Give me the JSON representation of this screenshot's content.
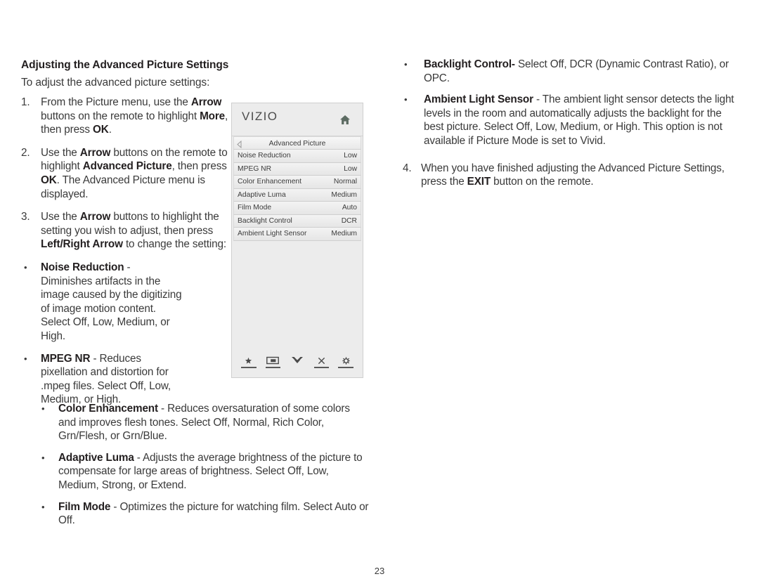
{
  "document": {
    "section_title": "Adjusting the Advanced Picture Settings",
    "intro": "To adjust the advanced picture settings:",
    "page_number": "23"
  },
  "steps_left": [
    {
      "num": "1.",
      "html": "From the Picture menu, use the <b>Arrow</b> buttons on the remote to highlight <b>More</b>, then press <b>OK</b>."
    },
    {
      "num": "2.",
      "html": "Use the <b>Arrow</b> buttons on the remote to highlight <b>Advanced Picture</b>, then press <b>OK</b>. The Advanced Picture menu is displayed."
    },
    {
      "num": "3.",
      "html": "Use the <b>Arrow</b> buttons to highlight the setting you wish to adjust, then press <b>Left/Right Arrow</b> to change the setting:"
    }
  ],
  "bullets_narrow": [
    {
      "dot": "•",
      "html": "<b>Noise Reduction</b> - Diminishes artifacts in the image caused by the digitizing of image motion content. Select Off, Low, Medium, or High."
    },
    {
      "dot": "•",
      "html": "<b>MPEG NR</b> - Reduces pixellation and distortion for .mpeg files. Select Off, Low, Medium, or High."
    }
  ],
  "bullets_wide": [
    {
      "dot": "•",
      "html": "<b>Color Enhancement</b> - Reduces oversaturation of some colors and improves flesh tones. Select Off, Normal, Rich Color, Grn/Flesh, or Grn/Blue."
    },
    {
      "dot": "•",
      "html": "<b>Adaptive Luma</b> - Adjusts the average brightness of the picture to compensate for large areas of brightness. Select Off, Low, Medium, Strong, or Extend."
    },
    {
      "dot": "•",
      "html": "<b>Film Mode</b> - Optimizes the picture for watching film. Select Auto or Off."
    }
  ],
  "bullets_right": [
    {
      "dot": "•",
      "html": "<b>Backlight Control-</b> Select Off, DCR (Dynamic Contrast Ratio), or OPC."
    },
    {
      "dot": "•",
      "html": "<b>Ambient Light Sensor</b> - The ambient light sensor detects the light levels in the room and automatically adjusts the backlight for the best picture. Select Off, Low, Medium, or High. This option is not available if Picture Mode is set to Vivid."
    }
  ],
  "steps_right": [
    {
      "num": "4.",
      "html": "When you have finished adjusting the Advanced Picture Settings, press the <b>EXIT</b> button on the remote."
    }
  ],
  "tv_menu": {
    "brand": "VIZIO",
    "home_icon": "home-icon",
    "back_icon": "back-arrow-icon",
    "menu_title": "Advanced Picture",
    "rows": [
      {
        "label": "Noise Reduction",
        "value": "Low"
      },
      {
        "label": "MPEG NR",
        "value": "Low"
      },
      {
        "label": "Color Enhancement",
        "value": "Normal"
      },
      {
        "label": "Adaptive Luma",
        "value": "Medium"
      },
      {
        "label": "Film Mode",
        "value": "Auto"
      },
      {
        "label": "Backlight Control",
        "value": "DCR"
      },
      {
        "label": "Ambient Light Sensor",
        "value": "Medium"
      }
    ],
    "footer_icons": [
      {
        "name": "star-icon"
      },
      {
        "name": "picture-in-picture-icon"
      },
      {
        "name": "double-chevron-down-icon"
      },
      {
        "name": "close-x-icon"
      },
      {
        "name": "gear-icon"
      }
    ]
  }
}
